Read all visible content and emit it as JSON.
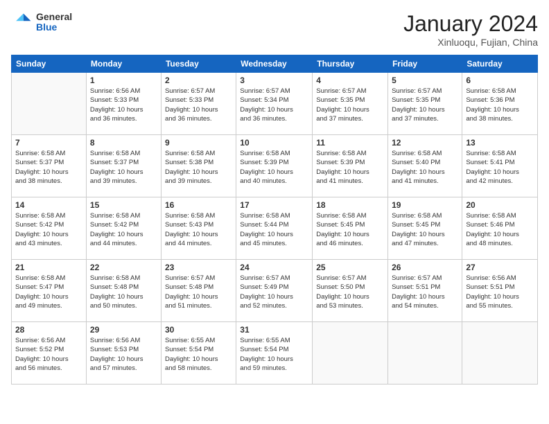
{
  "header": {
    "logo_general": "General",
    "logo_blue": "Blue",
    "title": "January 2024",
    "location": "Xinluoqu, Fujian, China"
  },
  "days_of_week": [
    "Sunday",
    "Monday",
    "Tuesday",
    "Wednesday",
    "Thursday",
    "Friday",
    "Saturday"
  ],
  "weeks": [
    [
      {
        "day": "",
        "info": ""
      },
      {
        "day": "1",
        "info": "Sunrise: 6:56 AM\nSunset: 5:33 PM\nDaylight: 10 hours\nand 36 minutes."
      },
      {
        "day": "2",
        "info": "Sunrise: 6:57 AM\nSunset: 5:33 PM\nDaylight: 10 hours\nand 36 minutes."
      },
      {
        "day": "3",
        "info": "Sunrise: 6:57 AM\nSunset: 5:34 PM\nDaylight: 10 hours\nand 36 minutes."
      },
      {
        "day": "4",
        "info": "Sunrise: 6:57 AM\nSunset: 5:35 PM\nDaylight: 10 hours\nand 37 minutes."
      },
      {
        "day": "5",
        "info": "Sunrise: 6:57 AM\nSunset: 5:35 PM\nDaylight: 10 hours\nand 37 minutes."
      },
      {
        "day": "6",
        "info": "Sunrise: 6:58 AM\nSunset: 5:36 PM\nDaylight: 10 hours\nand 38 minutes."
      }
    ],
    [
      {
        "day": "7",
        "info": "Sunrise: 6:58 AM\nSunset: 5:37 PM\nDaylight: 10 hours\nand 38 minutes."
      },
      {
        "day": "8",
        "info": "Sunrise: 6:58 AM\nSunset: 5:37 PM\nDaylight: 10 hours\nand 39 minutes."
      },
      {
        "day": "9",
        "info": "Sunrise: 6:58 AM\nSunset: 5:38 PM\nDaylight: 10 hours\nand 39 minutes."
      },
      {
        "day": "10",
        "info": "Sunrise: 6:58 AM\nSunset: 5:39 PM\nDaylight: 10 hours\nand 40 minutes."
      },
      {
        "day": "11",
        "info": "Sunrise: 6:58 AM\nSunset: 5:39 PM\nDaylight: 10 hours\nand 41 minutes."
      },
      {
        "day": "12",
        "info": "Sunrise: 6:58 AM\nSunset: 5:40 PM\nDaylight: 10 hours\nand 41 minutes."
      },
      {
        "day": "13",
        "info": "Sunrise: 6:58 AM\nSunset: 5:41 PM\nDaylight: 10 hours\nand 42 minutes."
      }
    ],
    [
      {
        "day": "14",
        "info": "Sunrise: 6:58 AM\nSunset: 5:42 PM\nDaylight: 10 hours\nand 43 minutes."
      },
      {
        "day": "15",
        "info": "Sunrise: 6:58 AM\nSunset: 5:42 PM\nDaylight: 10 hours\nand 44 minutes."
      },
      {
        "day": "16",
        "info": "Sunrise: 6:58 AM\nSunset: 5:43 PM\nDaylight: 10 hours\nand 44 minutes."
      },
      {
        "day": "17",
        "info": "Sunrise: 6:58 AM\nSunset: 5:44 PM\nDaylight: 10 hours\nand 45 minutes."
      },
      {
        "day": "18",
        "info": "Sunrise: 6:58 AM\nSunset: 5:45 PM\nDaylight: 10 hours\nand 46 minutes."
      },
      {
        "day": "19",
        "info": "Sunrise: 6:58 AM\nSunset: 5:45 PM\nDaylight: 10 hours\nand 47 minutes."
      },
      {
        "day": "20",
        "info": "Sunrise: 6:58 AM\nSunset: 5:46 PM\nDaylight: 10 hours\nand 48 minutes."
      }
    ],
    [
      {
        "day": "21",
        "info": "Sunrise: 6:58 AM\nSunset: 5:47 PM\nDaylight: 10 hours\nand 49 minutes."
      },
      {
        "day": "22",
        "info": "Sunrise: 6:58 AM\nSunset: 5:48 PM\nDaylight: 10 hours\nand 50 minutes."
      },
      {
        "day": "23",
        "info": "Sunrise: 6:57 AM\nSunset: 5:48 PM\nDaylight: 10 hours\nand 51 minutes."
      },
      {
        "day": "24",
        "info": "Sunrise: 6:57 AM\nSunset: 5:49 PM\nDaylight: 10 hours\nand 52 minutes."
      },
      {
        "day": "25",
        "info": "Sunrise: 6:57 AM\nSunset: 5:50 PM\nDaylight: 10 hours\nand 53 minutes."
      },
      {
        "day": "26",
        "info": "Sunrise: 6:57 AM\nSunset: 5:51 PM\nDaylight: 10 hours\nand 54 minutes."
      },
      {
        "day": "27",
        "info": "Sunrise: 6:56 AM\nSunset: 5:51 PM\nDaylight: 10 hours\nand 55 minutes."
      }
    ],
    [
      {
        "day": "28",
        "info": "Sunrise: 6:56 AM\nSunset: 5:52 PM\nDaylight: 10 hours\nand 56 minutes."
      },
      {
        "day": "29",
        "info": "Sunrise: 6:56 AM\nSunset: 5:53 PM\nDaylight: 10 hours\nand 57 minutes."
      },
      {
        "day": "30",
        "info": "Sunrise: 6:55 AM\nSunset: 5:54 PM\nDaylight: 10 hours\nand 58 minutes."
      },
      {
        "day": "31",
        "info": "Sunrise: 6:55 AM\nSunset: 5:54 PM\nDaylight: 10 hours\nand 59 minutes."
      },
      {
        "day": "",
        "info": ""
      },
      {
        "day": "",
        "info": ""
      },
      {
        "day": "",
        "info": ""
      }
    ]
  ]
}
